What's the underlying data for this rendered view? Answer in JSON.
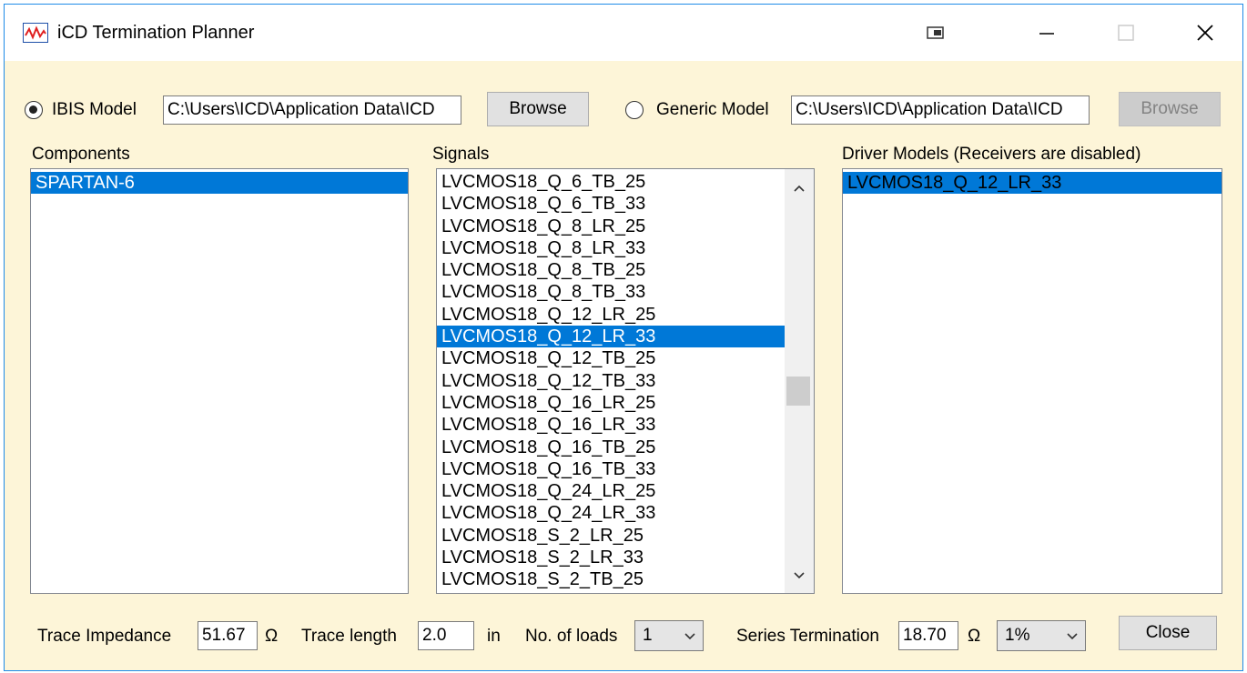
{
  "window": {
    "title": "iCD Termination Planner",
    "controls": [
      "restore-icon",
      "minimize-icon",
      "maximize-icon",
      "close-icon"
    ]
  },
  "model_source": {
    "ibis": {
      "label": "IBIS Model",
      "selected": true,
      "path": "C:\\Users\\ICD\\Application Data\\ICD",
      "browse_label": "Browse"
    },
    "generic": {
      "label": "Generic Model",
      "selected": false,
      "path": "C:\\Users\\ICD\\Application Data\\ICD",
      "browse_label": "Browse"
    }
  },
  "components": {
    "header": "Components",
    "items": [
      "SPARTAN-6"
    ],
    "selected_index": 0
  },
  "signals": {
    "header": "Signals",
    "items": [
      "LVCMOS18_Q_6_TB_25",
      "LVCMOS18_Q_6_TB_33",
      "LVCMOS18_Q_8_LR_25",
      "LVCMOS18_Q_8_LR_33",
      "LVCMOS18_Q_8_TB_25",
      "LVCMOS18_Q_8_TB_33",
      "LVCMOS18_Q_12_LR_25",
      "LVCMOS18_Q_12_LR_33",
      "LVCMOS18_Q_12_TB_25",
      "LVCMOS18_Q_12_TB_33",
      "LVCMOS18_Q_16_LR_25",
      "LVCMOS18_Q_16_LR_33",
      "LVCMOS18_Q_16_TB_25",
      "LVCMOS18_Q_16_TB_33",
      "LVCMOS18_Q_24_LR_25",
      "LVCMOS18_Q_24_LR_33",
      "LVCMOS18_S_2_LR_25",
      "LVCMOS18_S_2_LR_33",
      "LVCMOS18_S_2_TB_25"
    ],
    "selected_index": 7
  },
  "driver_models": {
    "header": "Driver Models (Receivers are disabled)",
    "items": [
      "LVCMOS18_Q_12_LR_33"
    ],
    "selected_index": 0
  },
  "footer": {
    "trace_impedance_label": "Trace Impedance",
    "trace_impedance_value": "51.67",
    "ohm_unit": "Ω",
    "trace_length_label": "Trace length",
    "trace_length_value": "2.0",
    "length_unit": "in",
    "loads_label": "No. of loads",
    "loads_value": "1",
    "series_termination_label": "Series Termination",
    "series_termination_value": "18.70",
    "tolerance_value": "1%",
    "close_label": "Close"
  },
  "colors": {
    "selection": "#0078d7",
    "window_bg": "#fdf5d8",
    "border": "#1e8be8"
  }
}
